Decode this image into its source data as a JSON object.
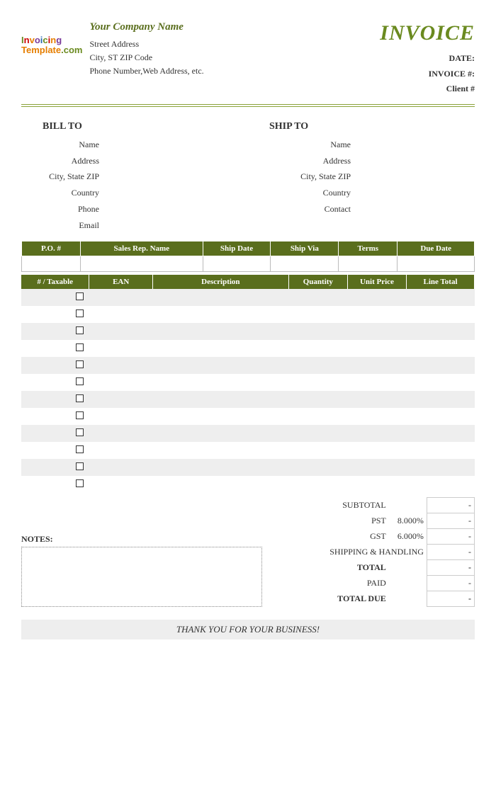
{
  "header": {
    "company_name": "Your Company Name",
    "address_lines": [
      "Street Address",
      "City, ST  ZIP Code",
      "Phone Number,Web Address, etc."
    ],
    "invoice_title": "INVOICE",
    "meta_labels": [
      "DATE:",
      "INVOICE #:",
      "Client #"
    ],
    "logo": {
      "l1_text": "Invoicing",
      "l2_text": "Template",
      "l2_suffix": ".com"
    }
  },
  "bill_to": {
    "title": "BILL TO",
    "labels": [
      "Name",
      "Address",
      "City, State ZIP",
      "Country",
      "Phone",
      "Email"
    ]
  },
  "ship_to": {
    "title": "SHIP TO",
    "labels": [
      "Name",
      "Address",
      "City, State ZIP",
      "Country",
      "Contact"
    ]
  },
  "meta_table": {
    "headers": [
      "P.O. #",
      "Sales Rep. Name",
      "Ship Date",
      "Ship Via",
      "Terms",
      "Due Date"
    ]
  },
  "item_table": {
    "headers": [
      "# / Taxable",
      "EAN",
      "Description",
      "Quantity",
      "Unit Price",
      "Line Total"
    ],
    "row_count": 12
  },
  "totals": {
    "rows": [
      {
        "label": "SUBTOTAL",
        "perc": "",
        "val": "-",
        "bold": false
      },
      {
        "label": "PST",
        "perc": "8.000%",
        "val": "-",
        "bold": false
      },
      {
        "label": "GST",
        "perc": "6.000%",
        "val": "-",
        "bold": false
      },
      {
        "label": "SHIPPING & HANDLING",
        "perc": "",
        "val": "-",
        "bold": false,
        "span": true
      },
      {
        "label": "TOTAL",
        "perc": "",
        "val": "-",
        "bold": true
      },
      {
        "label": "PAID",
        "perc": "",
        "val": "-",
        "bold": false
      },
      {
        "label": "TOTAL DUE",
        "perc": "",
        "val": "-",
        "bold": true
      }
    ]
  },
  "notes_label": "NOTES:",
  "thanks": "THANK YOU FOR YOUR BUSINESS!",
  "watermark": ""
}
